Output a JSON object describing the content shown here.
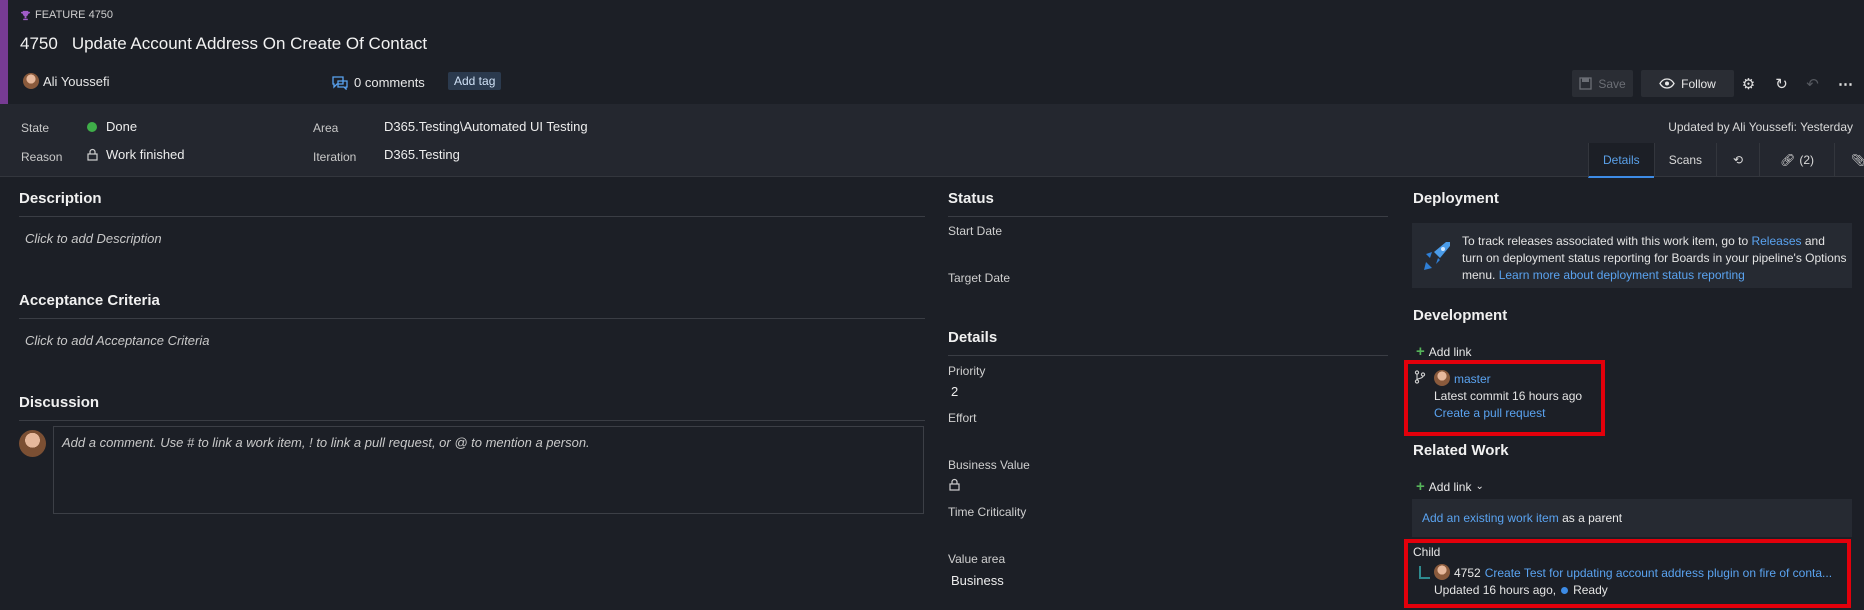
{
  "header": {
    "feature_type": "FEATURE 4750",
    "id": "4750",
    "title": "Update Account Address On Create Of Contact",
    "owner": "Ali Youssefi",
    "comments": "0 comments",
    "add_tag": "Add tag",
    "save_label": "Save",
    "follow_label": "Follow"
  },
  "info": {
    "state_label": "State",
    "state_value": "Done",
    "reason_label": "Reason",
    "reason_value": "Work finished",
    "area_label": "Area",
    "area_value": "D365.Testing\\Automated UI Testing",
    "iteration_label": "Iteration",
    "iteration_value": "D365.Testing",
    "updated_by": "Updated by Ali Youssefi: Yesterday"
  },
  "tabs": {
    "details": "Details",
    "scans": "Scans",
    "links": "(2)"
  },
  "left": {
    "description_h": "Description",
    "description_ph": "Click to add Description",
    "acceptance_h": "Acceptance Criteria",
    "acceptance_ph": "Click to add Acceptance Criteria",
    "discussion_h": "Discussion",
    "comment_ph": "Add a comment. Use # to link a work item, ! to link a pull request, or @ to mention a person."
  },
  "middle": {
    "status_h": "Status",
    "start_date": "Start Date",
    "target_date": "Target Date",
    "details_h": "Details",
    "priority_label": "Priority",
    "priority_value": "2",
    "effort_label": "Effort",
    "business_value_label": "Business Value",
    "time_criticality_label": "Time Criticality",
    "value_area_label": "Value area",
    "value_area_value": "Business"
  },
  "right": {
    "deployment_h": "Deployment",
    "deploy_text_1": "To track releases associated with this work item, go to",
    "deploy_link_releases": "Releases",
    "deploy_text_2": "and turn on deployment status reporting for Boards in your pipeline's Options menu.",
    "deploy_link_learn": "Learn more about deployment status reporting",
    "development_h": "Development",
    "add_link": "Add link",
    "branch": "master",
    "latest_commit": "Latest commit 16 hours ago",
    "create_pr": "Create a pull request",
    "related_h": "Related Work",
    "add_existing_link": "Add an existing work item",
    "as_parent": "as a parent",
    "child_label": "Child",
    "child_id": "4752",
    "child_title": "Create Test for updating account address plugin on fire of conta...",
    "child_updated": "Updated 16 hours ago,",
    "child_state": "Ready"
  },
  "colors": {
    "accent": "#773b93",
    "link": "#5aa3f0",
    "done_green": "#3fae49",
    "highlight_red": "#e3000b"
  }
}
